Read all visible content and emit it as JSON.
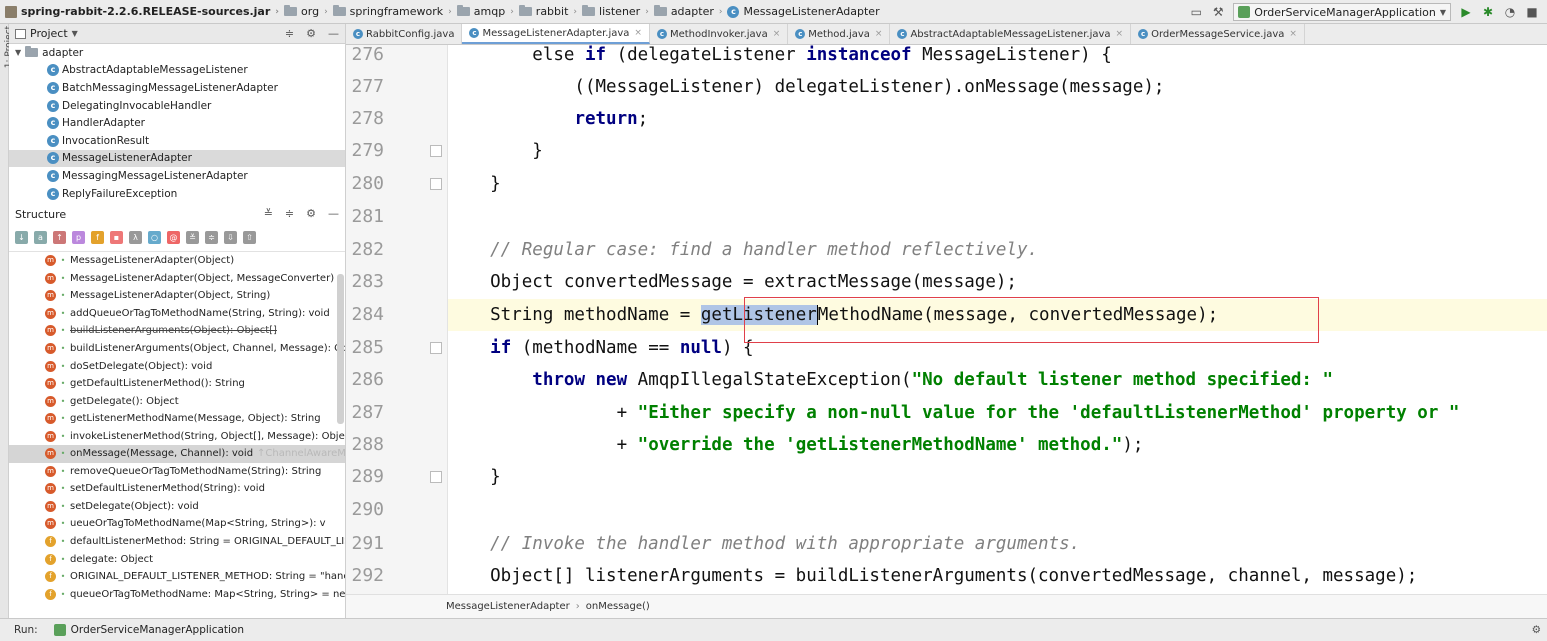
{
  "breadcrumb": [
    {
      "label": "spring-rabbit-2.2.6.RELEASE-sources.jar",
      "icon": "jar-icon"
    },
    {
      "label": "org",
      "icon": "folder-icon"
    },
    {
      "label": "springframework",
      "icon": "folder-icon"
    },
    {
      "label": "amqp",
      "icon": "folder-icon"
    },
    {
      "label": "rabbit",
      "icon": "folder-icon"
    },
    {
      "label": "listener",
      "icon": "folder-icon"
    },
    {
      "label": "adapter",
      "icon": "folder-icon"
    },
    {
      "label": "MessageListenerAdapter",
      "icon": "class-icon"
    }
  ],
  "run_config": {
    "label": "OrderServiceManagerApplication"
  },
  "left_stripe": {
    "label": "1: Project"
  },
  "project_panel": {
    "title": "Project",
    "root": "adapter",
    "items": [
      "AbstractAdaptableMessageListener",
      "BatchMessagingMessageListenerAdapter",
      "DelegatingInvocableHandler",
      "HandlerAdapter",
      "InvocationResult",
      "MessageListenerAdapter",
      "MessagingMessageListenerAdapter",
      "ReplyFailureException"
    ],
    "selected": 5
  },
  "structure_panel": {
    "title": "Structure",
    "items": [
      {
        "label": "MessageListenerAdapter(Object)",
        "kind": "method"
      },
      {
        "label": "MessageListenerAdapter(Object, MessageConverter)",
        "kind": "method"
      },
      {
        "label": "MessageListenerAdapter(Object, String)",
        "kind": "method"
      },
      {
        "label": "addQueueOrTagToMethodName(String, String): void",
        "kind": "method"
      },
      {
        "label": "buildListenerArguments(Object): Object[]",
        "kind": "method",
        "deprecated": true
      },
      {
        "label": "buildListenerArguments(Object, Channel, Message): Obj",
        "kind": "method"
      },
      {
        "label": "doSetDelegate(Object): void",
        "kind": "method"
      },
      {
        "label": "getDefaultListenerMethod(): String",
        "kind": "method"
      },
      {
        "label": "getDelegate(): Object",
        "kind": "method"
      },
      {
        "label": "getListenerMethodName(Message, Object): String",
        "kind": "method"
      },
      {
        "label": "invokeListenerMethod(String, Object[], Message): Objec",
        "kind": "method"
      },
      {
        "label": "onMessage(Message, Channel): void",
        "suffix": "↑ChannelAwareMe",
        "kind": "method",
        "selected": true
      },
      {
        "label": "removeQueueOrTagToMethodName(String): String",
        "kind": "method"
      },
      {
        "label": "setDefaultListenerMethod(String): void",
        "kind": "method"
      },
      {
        "label": "setDelegate(Object): void",
        "kind": "method"
      },
      {
        "label": "ueueOrTagToMethodName(Map<String, String>): v",
        "kind": "method"
      },
      {
        "label": "defaultListenerMethod: String = ORIGINAL_DEFAULT_LIS",
        "kind": "field"
      },
      {
        "label": "delegate: Object",
        "kind": "field"
      },
      {
        "label": "ORIGINAL_DEFAULT_LISTENER_METHOD: String = \"hanc",
        "kind": "field"
      },
      {
        "label": "queueOrTagToMethodName: Map<String, String> = ne",
        "kind": "field"
      }
    ]
  },
  "editor": {
    "tabs": [
      {
        "label": "RabbitConfig.java",
        "closable": false
      },
      {
        "label": "MessageListenerAdapter.java",
        "closable": true,
        "active": true
      },
      {
        "label": "MethodInvoker.java",
        "closable": true
      },
      {
        "label": "Method.java",
        "closable": true
      },
      {
        "label": "AbstractAdaptableMessageListener.java",
        "closable": true
      },
      {
        "label": "OrderMessageService.java",
        "closable": true
      }
    ],
    "lines": [
      "276",
      "277",
      "278",
      "279",
      "280",
      "281",
      "282",
      "283",
      "284",
      "285",
      "286",
      "287",
      "288",
      "289",
      "290",
      "291",
      "292"
    ],
    "code": {
      "l276a": "        else ",
      "l276b": "if",
      "l276c": " (delegateListener ",
      "l276d": "instanceof",
      "l276e": " MessageListener) {",
      "l277": "            ((MessageListener) delegateListener).onMessage(message);",
      "l278a": "            ",
      "l278b": "return",
      "l278c": ";",
      "l279": "        }",
      "l280": "    }",
      "l282": "    // Regular case: find a handler method reflectively.",
      "l283": "    Object convertedMessage = extractMessage(message);",
      "l284a": "    String methodName = ",
      "l284sel": "getListener",
      "l284b": "MethodName(message, convertedMessage);",
      "l285a": "    ",
      "l285b": "if",
      "l285c": " (methodName == ",
      "l285d": "null",
      "l285e": ") {",
      "l286a": "        ",
      "l286b": "throw new",
      "l286c": " AmqpIllegalStateException(",
      "l286d": "\"No default listener method specified: \"",
      "l287a": "                + ",
      "l287b": "\"Either specify a non-null value for the 'defaultListenerMethod' property or \"",
      "l288a": "                + ",
      "l288b": "\"override the 'getListenerMethodName' method.\"",
      "l288c": ");",
      "l289": "    }",
      "l291": "    // Invoke the handler method with appropriate arguments.",
      "l292": "    Object[] listenerArguments = buildListenerArguments(convertedMessage, channel, message);"
    },
    "status_crumbs": [
      "MessageListenerAdapter",
      "onMessage()"
    ]
  },
  "run_bar": {
    "label": "Run:",
    "tab": "OrderServiceManagerApplication"
  }
}
